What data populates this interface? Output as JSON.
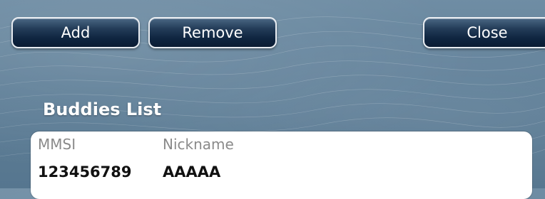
{
  "toolbar": {
    "add_label": "Add",
    "remove_label": "Remove",
    "close_label": "Close"
  },
  "buddies": {
    "title": "Buddies List",
    "columns": [
      "MMSI",
      "Nickname"
    ],
    "rows": [
      {
        "mmsi": "123456789",
        "nickname": "AAAAA"
      }
    ]
  },
  "colors": {
    "button_top": "#4a6784",
    "button_bottom": "#0b1c33",
    "button_border": "#e9edf2",
    "background": "#5f7f98",
    "header_text": "#8a8a8a"
  }
}
